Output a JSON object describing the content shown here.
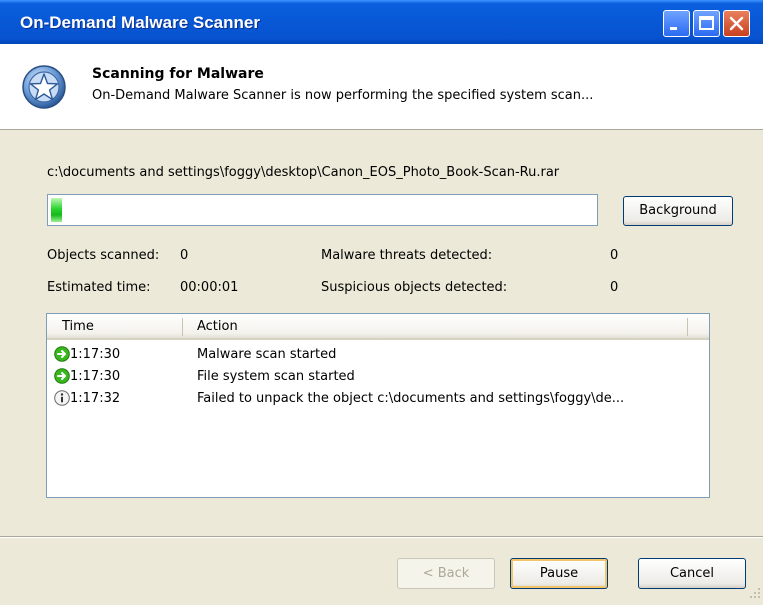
{
  "window": {
    "title": "On-Demand Malware Scanner"
  },
  "titlebar_buttons": [
    "minimize-icon",
    "maximize-icon",
    "close-icon"
  ],
  "header": {
    "title": "Scanning for Malware",
    "subtitle": "On-Demand Malware Scanner is now performing the specified system scan...",
    "icon": "shield-star-icon"
  },
  "scan": {
    "current_path": "c:\\documents and settings\\foggy\\desktop\\Canon_EOS_Photo_Book-Scan-Ru.rar",
    "progress_fraction": 0.02,
    "background_label": "Background"
  },
  "stats": {
    "objects_scanned_label": "Objects scanned:",
    "objects_scanned_value": "0",
    "estimated_time_label": "Estimated time:",
    "estimated_time_value": "00:00:01",
    "threats_label": "Malware threats detected:",
    "threats_value": "0",
    "suspicious_label": "Suspicious objects detected:",
    "suspicious_value": "0"
  },
  "log": {
    "columns": [
      "Time",
      "Action"
    ],
    "rows": [
      {
        "icon": "green-arrow-icon",
        "time": "1:17:30",
        "action": "Malware scan started"
      },
      {
        "icon": "green-arrow-icon",
        "time": "1:17:30",
        "action": "File system scan started"
      },
      {
        "icon": "info-icon",
        "time": "1:17:32",
        "action": "Failed to unpack the object c:\\documents and settings\\foggy\\de..."
      }
    ]
  },
  "buttons": {
    "back": "< Back",
    "pause": "Pause",
    "cancel": "Cancel"
  },
  "colors": {
    "titlebar": "#0858d6",
    "progress": "#22c826",
    "dialog_bg": "#ece9d8"
  }
}
